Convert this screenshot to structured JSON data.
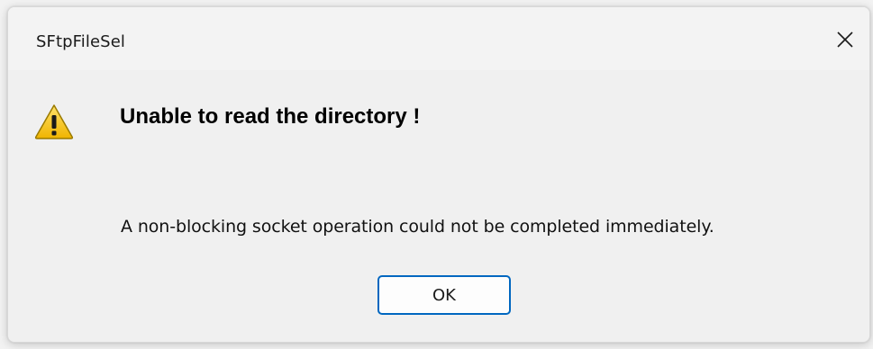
{
  "window": {
    "title": "SFtpFileSel",
    "close_icon": "close-icon"
  },
  "dialog": {
    "icon": "warning-icon",
    "headline": "Unable to read the directory !",
    "message": "A non-blocking socket operation could not be completed immediately.",
    "ok_label": "OK"
  },
  "colors": {
    "accent": "#0067c0",
    "warning_fill": "#f5c400",
    "background": "#f0f0f0"
  }
}
